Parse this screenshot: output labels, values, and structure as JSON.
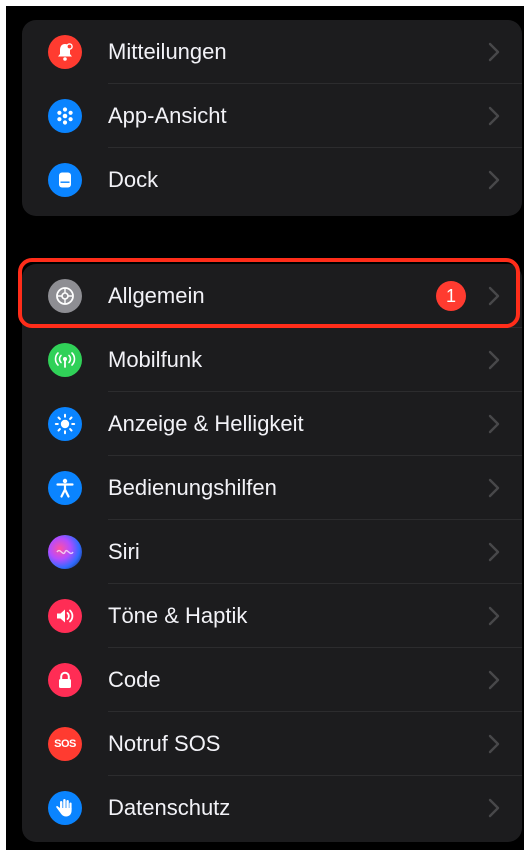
{
  "group_top": {
    "items": [
      {
        "label": "Mitteilungen",
        "icon": "notification-bell-icon",
        "color": "#ff3b30"
      },
      {
        "label": "App-Ansicht",
        "icon": "app-grid-icon",
        "color": "#0a84ff"
      },
      {
        "label": "Dock",
        "icon": "dock-icon",
        "color": "#0a84ff"
      }
    ]
  },
  "group_main": {
    "items": [
      {
        "label": "Allgemein",
        "icon": "gear-icon",
        "color": "#8e8e93",
        "badge": "1"
      },
      {
        "label": "Mobilfunk",
        "icon": "antenna-icon",
        "color": "#30d158"
      },
      {
        "label": "Anzeige & Helligkeit",
        "icon": "brightness-sun-icon",
        "color": "#0a84ff"
      },
      {
        "label": "Bedienungshilfen",
        "icon": "accessibility-person-icon",
        "color": "#0a84ff"
      },
      {
        "label": "Siri",
        "icon": "siri-icon",
        "color": "#5e5ce6"
      },
      {
        "label": "Töne & Haptik",
        "icon": "speaker-icon",
        "color": "#ff2d55"
      },
      {
        "label": "Code",
        "icon": "lock-icon",
        "color": "#ff2d55"
      },
      {
        "label": "Notruf SOS",
        "icon": "sos-icon",
        "color": "#ff3b30",
        "icon_text": "SOS"
      },
      {
        "label": "Datenschutz",
        "icon": "hand-icon",
        "color": "#0a84ff"
      }
    ]
  },
  "highlight_color": "#ff2d1a"
}
